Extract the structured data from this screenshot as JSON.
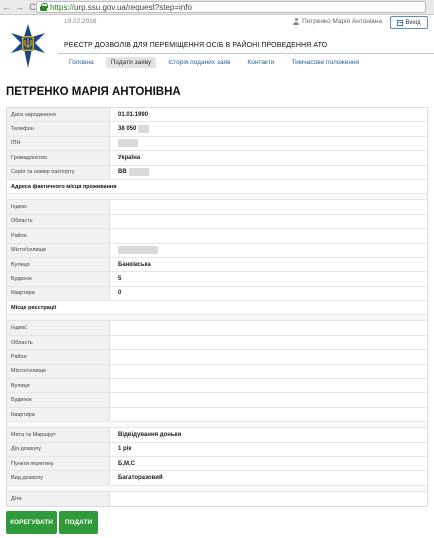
{
  "browser": {
    "back_glyph": "←",
    "forward_glyph": "→",
    "reload_glyph": "C",
    "url_scheme": "https://",
    "url_rest": "urp.ssu.gov.ua/request?step=info"
  },
  "header": {
    "date": "19.02.2016",
    "user_name": "Петренко Марія Антонівна",
    "logout_label": "Вихід",
    "registry_title": "РЕЄСТР ДОЗВОЛІВ ДЛЯ ПЕРЕМІЩЕННЯ ОСІБ В РАЙОНІ ПРОВЕДЕННЯ АТО",
    "tabs": [
      {
        "label": "Головна"
      },
      {
        "label": "Подати заяву"
      },
      {
        "label": "Історія поданих заяв"
      },
      {
        "label": "Контакти"
      },
      {
        "label": "Тимчасове положення"
      }
    ]
  },
  "person": {
    "name": "ПЕТРЕНКО МАРІЯ АНТОНІВНА"
  },
  "form": {
    "personal": [
      {
        "label": "Дата народження",
        "value": "01.01.1990"
      },
      {
        "label": "Телефон",
        "value": "38 050"
      },
      {
        "label": "ІПН",
        "value": ""
      },
      {
        "label": "Громадянство",
        "value": "Україна"
      },
      {
        "label": "Серія та номер паспорту",
        "value": "ВВ"
      }
    ],
    "actual_address_title": "Адреса фактичного місця проживання",
    "actual_address": [
      {
        "label": "Індекс",
        "value": ""
      },
      {
        "label": "Область",
        "value": ""
      },
      {
        "label": "Район",
        "value": ""
      },
      {
        "label": "Місто/селище",
        "value": ""
      },
      {
        "label": "Вулиця",
        "value": "Банківська"
      },
      {
        "label": "Будинок",
        "value": "5"
      },
      {
        "label": "Квартира",
        "value": "0"
      }
    ],
    "registration_title": "Місце реєстрації",
    "registration": [
      {
        "label": "Індекс",
        "value": ""
      },
      {
        "label": "Область",
        "value": ""
      },
      {
        "label": "Район",
        "value": ""
      },
      {
        "label": "Місто/селище",
        "value": ""
      },
      {
        "label": "Вулиця",
        "value": ""
      },
      {
        "label": "Будинок",
        "value": ""
      },
      {
        "label": "Квартира",
        "value": ""
      }
    ],
    "trip": [
      {
        "label": "Мета та Маршрут",
        "value": "Відвідування доньки"
      },
      {
        "label": "Дія дозволу",
        "value": "1 рік"
      },
      {
        "label": "Пункти перетину",
        "value": "Б,М,С"
      },
      {
        "label": "Вид дозволу",
        "value": "Багаторазовий"
      }
    ],
    "children_label": "Діти",
    "children_value": ""
  },
  "buttons": {
    "edit_label": "КОРЕГУВАТИ",
    "submit_label": "ПОДАТИ"
  },
  "colors": {
    "accent_green": "#2f9a3a",
    "link_blue": "#2d5f8f",
    "emblem_blue": "#1a4a86",
    "emblem_gold": "#d9a21b"
  }
}
